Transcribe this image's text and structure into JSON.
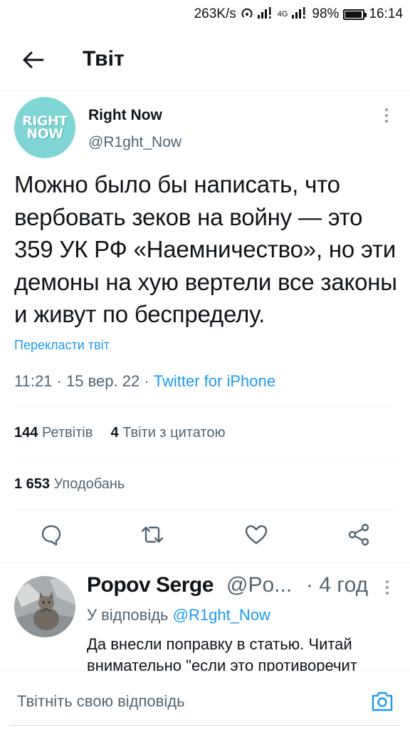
{
  "status_bar": {
    "net_speed": "263K/s",
    "network": "4G",
    "battery": "98%",
    "battery_level": 0.98,
    "time": "16:14"
  },
  "header": {
    "title": "Твіт"
  },
  "tweet": {
    "avatar_text_line1": "RIGHT",
    "avatar_text_line2": "NOW",
    "author_name": "Right Now",
    "author_handle": "@R1ght_Now",
    "text": "Можно было бы написать, что вербовать зеков на войну — это 359 УК РФ «Наемничество», но эти демоны на хую вертели все законы и живут по беспределу.",
    "translate_label": "Перекласти твіт",
    "time": "11:21",
    "date": "15 вер. 22",
    "separator": "·",
    "source": "Twitter for iPhone",
    "retweets_count": "144",
    "retweets_label": "Ретвітів",
    "quotes_count": "4",
    "quotes_label": "Твіти з цитатою",
    "likes_count": "1 653",
    "likes_label": "Уподобань"
  },
  "actions": {
    "reply_icon": "comment-icon",
    "retweet_icon": "retweet-icon",
    "like_icon": "heart-icon",
    "share_icon": "share-icon"
  },
  "reply": {
    "author_name": "Popov Serge",
    "author_handle": "@Po...",
    "time": "· 4 год",
    "reply_to_label": "У відповідь",
    "reply_to_handle": "@R1ght_Now",
    "text": "Да внесли поправку в статью. Читай внимательно \"если это противоречит"
  },
  "compose": {
    "placeholder": "Твітніть свою відповідь"
  },
  "colors": {
    "accent": "#1d9bf0",
    "secondary_text": "#536471",
    "avatar_bg": "#7fd6d5"
  }
}
